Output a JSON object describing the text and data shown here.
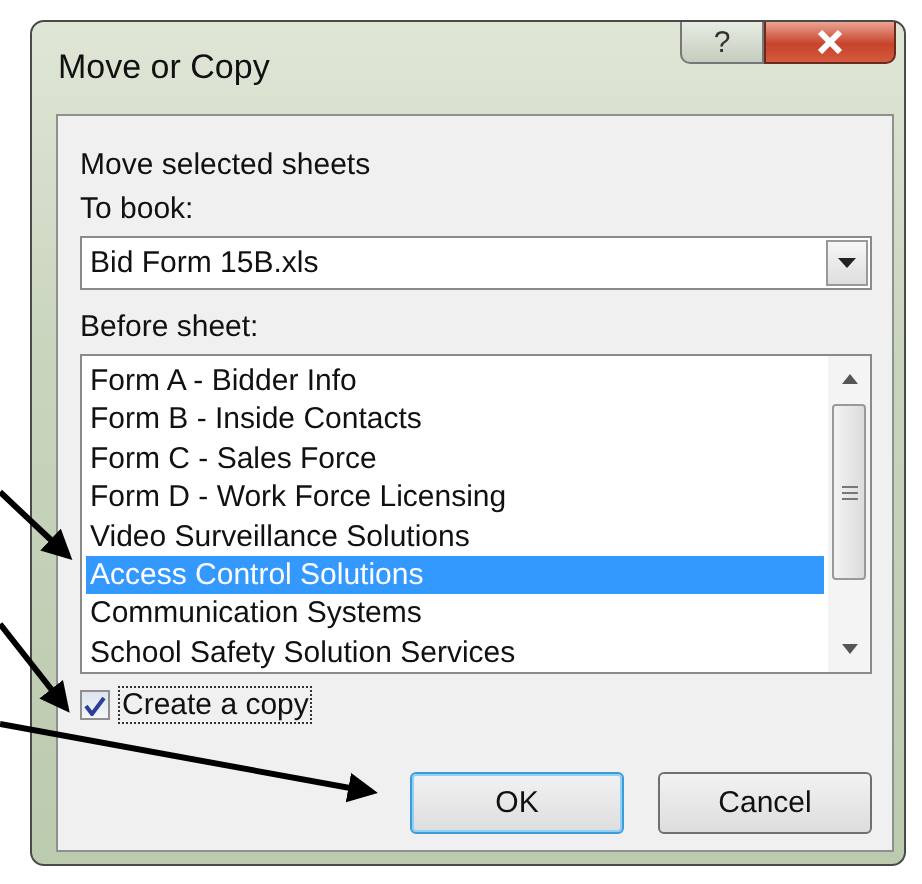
{
  "window": {
    "title": "Move or Copy",
    "help": "?"
  },
  "heading": "Move selected sheets",
  "to_book": {
    "label": "To book:",
    "value": "Bid Form 15B.xls"
  },
  "before_sheet": {
    "label": "Before sheet:",
    "items": [
      {
        "label": "Form A - Bidder Info",
        "selected": false
      },
      {
        "label": "Form B - Inside Contacts",
        "selected": false
      },
      {
        "label": "Form C - Sales Force",
        "selected": false
      },
      {
        "label": "Form D - Work Force Licensing",
        "selected": false
      },
      {
        "label": "Video Surveillance Solutions",
        "selected": false
      },
      {
        "label": "Access Control Solutions",
        "selected": true
      },
      {
        "label": "Communication Systems",
        "selected": false
      },
      {
        "label": "School Safety Solution Services",
        "selected": false
      }
    ]
  },
  "create_copy": {
    "label": "Create a copy",
    "checked": true
  },
  "buttons": [
    {
      "label": "OK",
      "default": true
    },
    {
      "label": "Cancel",
      "default": false
    }
  ]
}
